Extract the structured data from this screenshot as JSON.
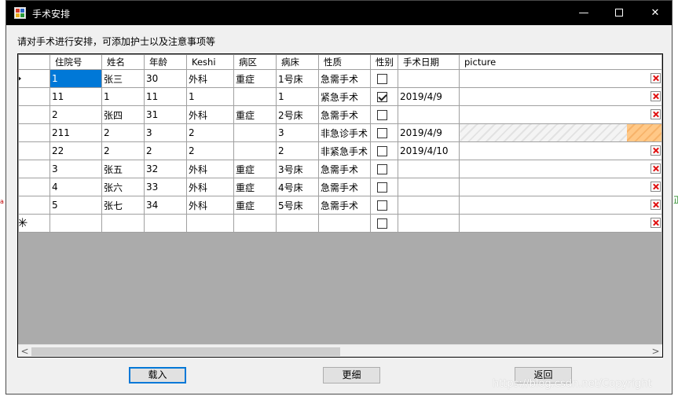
{
  "window": {
    "title": "手术安排",
    "min_label": "—",
    "close_label": "✕"
  },
  "instruction": "请对手术进行安排，可添加护士以及注意事项等",
  "grid": {
    "columns": [
      "住院号",
      "姓名",
      "年龄",
      "Keshi",
      "病区",
      "病床",
      "性质",
      "性别",
      "手术日期",
      "picture"
    ],
    "rows": [
      {
        "id": "1",
        "name": "张三",
        "age": "30",
        "keshi": "外科",
        "ward": "重症",
        "bed": "1号床",
        "nature": "急需手术",
        "gender_checked": false,
        "date": ""
      },
      {
        "id": "11",
        "name": "1",
        "age": "11",
        "keshi": "1",
        "ward": "",
        "bed": "1",
        "nature": "紧急手术",
        "gender_checked": true,
        "date": "2019/4/9"
      },
      {
        "id": "2",
        "name": "张四",
        "age": "31",
        "keshi": "外科",
        "ward": "重症",
        "bed": "2号床",
        "nature": "急需手术",
        "gender_checked": false,
        "date": ""
      },
      {
        "id": "211",
        "name": "2",
        "age": "3",
        "keshi": "2",
        "ward": "",
        "bed": "3",
        "nature": "非急诊手术",
        "gender_checked": false,
        "date": "2019/4/9"
      },
      {
        "id": "22",
        "name": "2",
        "age": "2",
        "keshi": "2",
        "ward": "",
        "bed": "2",
        "nature": "非紧急手术",
        "gender_checked": false,
        "date": "2019/4/10"
      },
      {
        "id": "3",
        "name": "张五",
        "age": "32",
        "keshi": "外科",
        "ward": "重症",
        "bed": "3号床",
        "nature": "急需手术",
        "gender_checked": false,
        "date": ""
      },
      {
        "id": "4",
        "name": "张六",
        "age": "33",
        "keshi": "外科",
        "ward": "重症",
        "bed": "4号床",
        "nature": "急需手术",
        "gender_checked": false,
        "date": ""
      },
      {
        "id": "5",
        "name": "张七",
        "age": "34",
        "keshi": "外科",
        "ward": "重症",
        "bed": "5号床",
        "nature": "急需手术",
        "gender_checked": false,
        "date": ""
      }
    ],
    "new_row_marker": "✳",
    "scroll_left": "<",
    "scroll_right": ">"
  },
  "buttons": {
    "load": "载入",
    "update": "更细",
    "back": "返回"
  },
  "side_text": {
    "left": "a",
    "right": "正"
  },
  "watermark": "https://blog.csdn.net/Copyright",
  "colors": {
    "selection": "#0078d7",
    "titlebar": "#000000",
    "grid_background": "#ababab",
    "image_placeholder": "#ffc887"
  }
}
